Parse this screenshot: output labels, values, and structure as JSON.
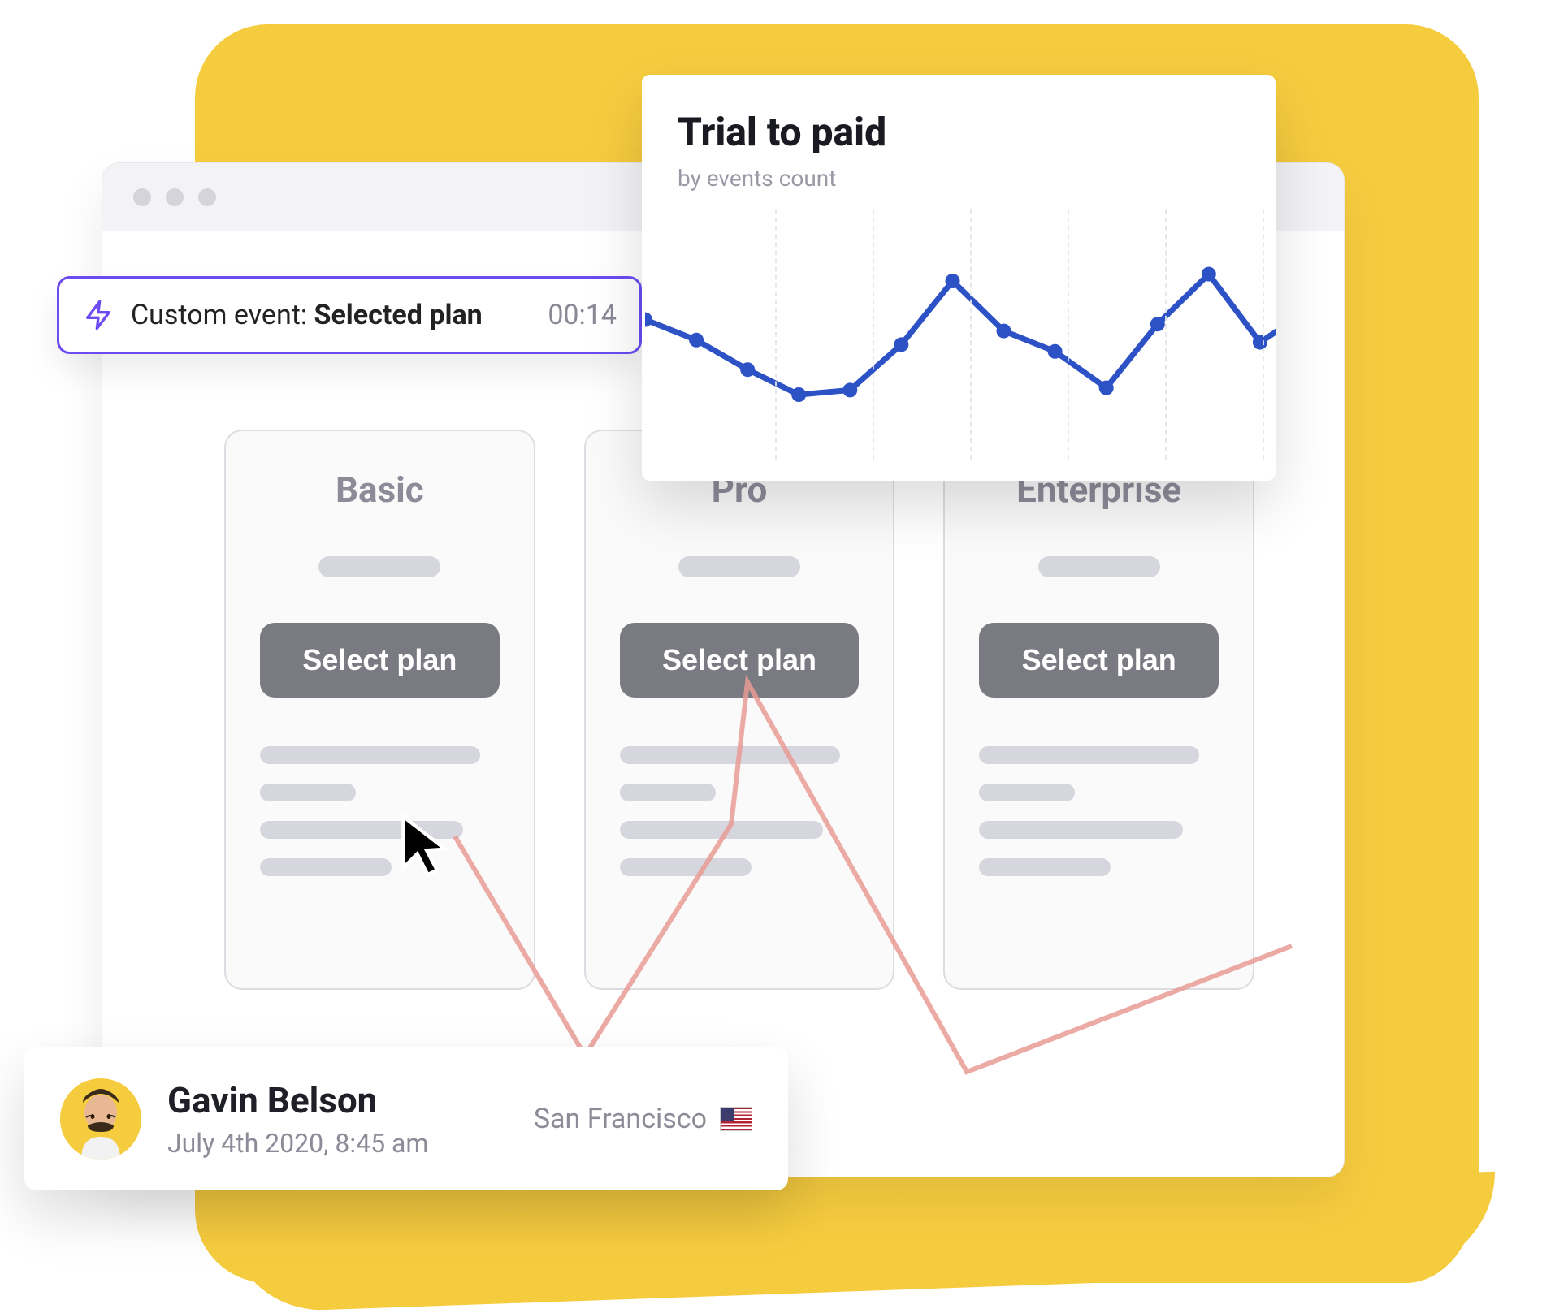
{
  "event_pill": {
    "prefix": "Custom event: ",
    "name": "Selected plan",
    "timestamp": "00:14"
  },
  "chart": {
    "title": "Trial to paid",
    "subtitle": "by events count"
  },
  "plans": {
    "basic": {
      "title": "Basic",
      "button": "Select plan"
    },
    "pro": {
      "title": "Pro",
      "button": "Select plan"
    },
    "enterprise": {
      "title": "Enterprise",
      "button": "Select plan"
    }
  },
  "user": {
    "name": "Gavin Belson",
    "date": "July 4th 2020, 8:45 am",
    "location": "San Francisco",
    "country_flag": "us"
  },
  "colors": {
    "accent_yellow": "#F6CC3F",
    "brand_purple": "#6C4CF1",
    "chart_blue": "#2C52C6",
    "trail_red": "#e99b95"
  },
  "chart_data": {
    "type": "line",
    "title": "Trial to paid",
    "ylabel": "events count",
    "xlabel": "",
    "x": [
      0,
      1,
      2,
      3,
      4,
      5,
      6,
      7,
      8,
      9,
      10,
      11
    ],
    "values": [
      58,
      49,
      36,
      25,
      27,
      47,
      75,
      53,
      44,
      28,
      56,
      78,
      48,
      63
    ],
    "ylim": [
      0,
      100
    ],
    "legend": false
  }
}
